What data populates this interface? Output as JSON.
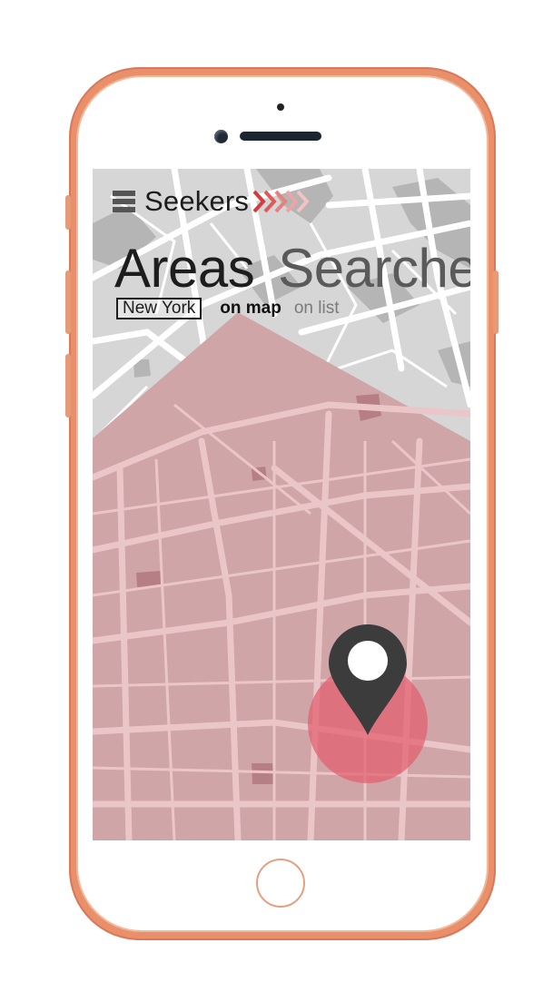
{
  "app": {
    "brand": "Seekers",
    "title_word1": "Areas",
    "title_word2": "Searched"
  },
  "filters": {
    "city": "New York",
    "view_map": "on map",
    "view_list": "on list"
  },
  "icons": {
    "menu": "menu-icon",
    "brand_arrows": "chevron-arrows-icon",
    "location": "map-pin-icon"
  },
  "colors": {
    "phone_frame": "#e9906a",
    "highlight_overlay": "#d9a0a5",
    "pin": "#3c3c3c",
    "pin_circle": "#e26270",
    "brand_arrows": "#d63a3a"
  }
}
